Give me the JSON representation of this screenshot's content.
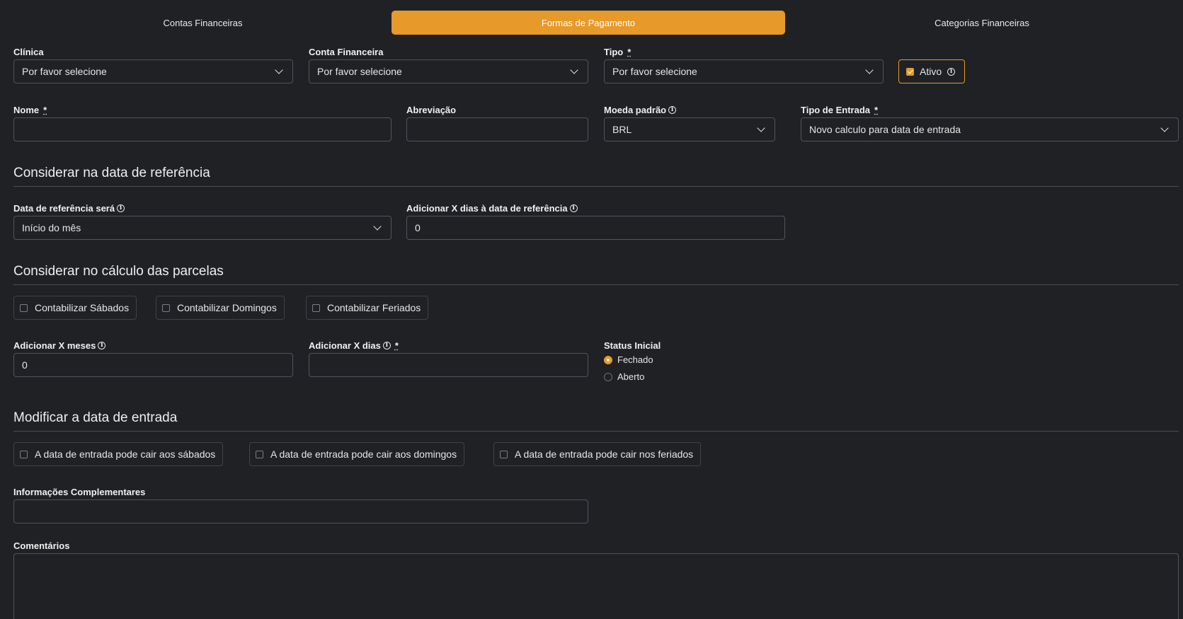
{
  "tabs": [
    "Contas Financeiras",
    "Formas de Pagamento",
    "Categorias Financeiras"
  ],
  "colors": {
    "accent": "#e79a29",
    "background": "#1f2125",
    "border": "#50545b"
  },
  "fields": {
    "clinica": {
      "label": "Clínica",
      "value": "Por favor selecione"
    },
    "conta": {
      "label": "Conta Financeira",
      "value": "Por favor selecione"
    },
    "tipo": {
      "label": "Tipo",
      "value": "Por favor selecione"
    },
    "ativo": {
      "label": "Ativo",
      "checked": true
    },
    "nome": {
      "label": "Nome",
      "value": ""
    },
    "abreviacao": {
      "label": "Abreviação",
      "value": ""
    },
    "moeda": {
      "label": "Moeda padrão",
      "value": "BRL"
    },
    "tipo_entrada": {
      "label": "Tipo de Entrada",
      "value": "Novo calculo para data de entrada"
    },
    "data_ref": {
      "label": "Data de referência será",
      "value": "Início do mês"
    },
    "dias_ref": {
      "label": "Adicionar X dias à data de referência",
      "value": "0"
    },
    "meses": {
      "label": "Adicionar X meses",
      "value": "0"
    },
    "dias": {
      "label": "Adicionar X dias",
      "value": ""
    },
    "info_comp": {
      "label": "Informações Complementares",
      "value": ""
    },
    "comentarios": {
      "label": "Comentários",
      "value": ""
    }
  },
  "required_mark": "*",
  "info_glyph": "i",
  "sections": {
    "referencia": "Considerar na data de referência",
    "parcelas": "Considerar no cálculo das parcelas",
    "entrada": "Modificar a data de entrada"
  },
  "parcelas_checks": [
    "Contabilizar Sábados",
    "Contabilizar Domingos",
    "Contabilizar Feriados"
  ],
  "entrada_checks": [
    "A data de entrada pode cair aos sábados",
    "A data de entrada pode cair aos domingos",
    "A data de entrada pode cair nos feriados"
  ],
  "status": {
    "label": "Status Inicial",
    "options": [
      "Fechado",
      "Aberto"
    ],
    "selected": "Fechado"
  }
}
